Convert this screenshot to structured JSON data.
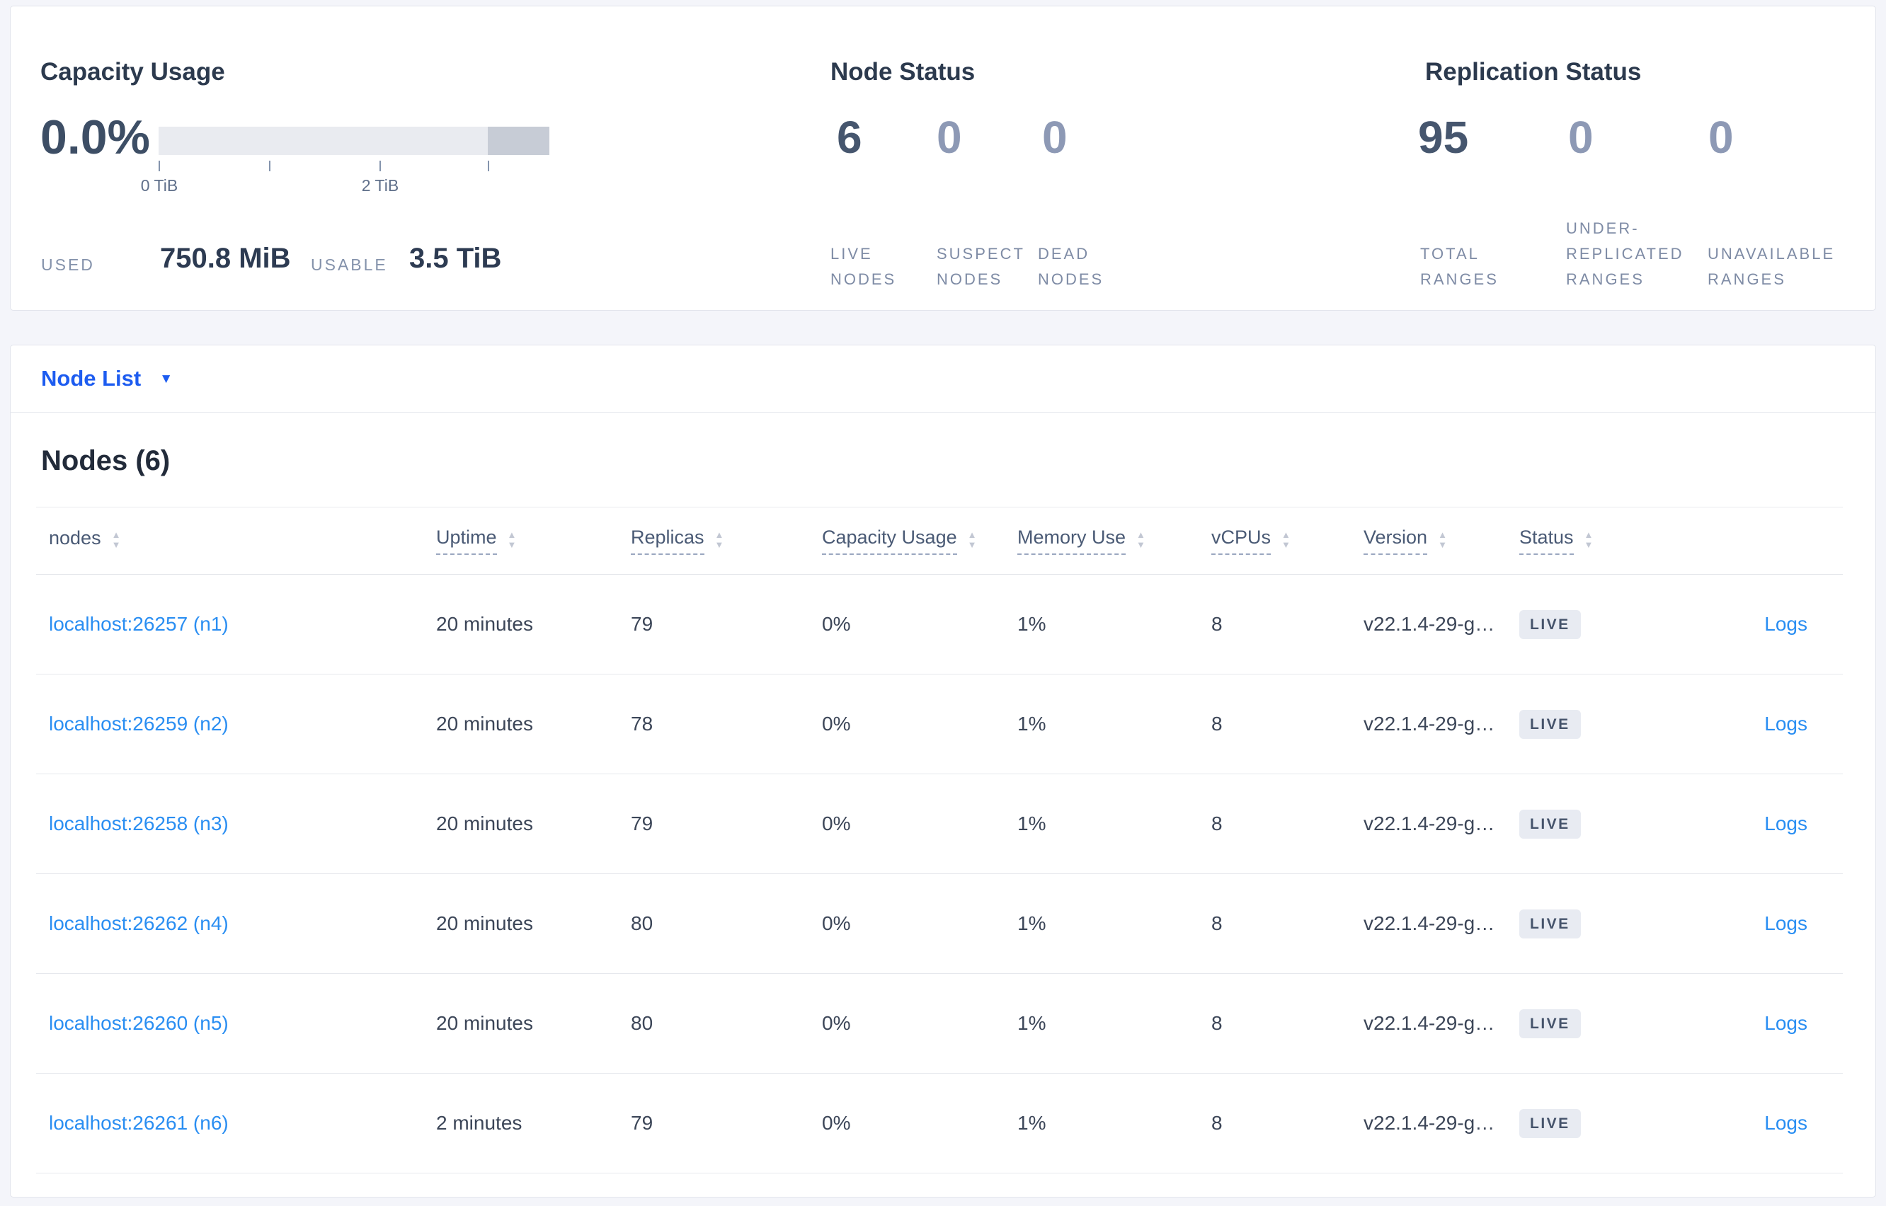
{
  "summary": {
    "capacity": {
      "title": "Capacity Usage",
      "percent": "0.0%",
      "tick_labels": [
        "0 TiB",
        "2 TiB"
      ],
      "used_label": "USED",
      "used_value": "750.8 MiB",
      "usable_label": "USABLE",
      "usable_value": "3.5 TiB"
    },
    "node_status": {
      "title": "Node Status",
      "stats": [
        {
          "value": "6",
          "lines": [
            "LIVE",
            "NODES"
          ]
        },
        {
          "value": "0",
          "lines": [
            "SUSPECT",
            "NODES"
          ]
        },
        {
          "value": "0",
          "lines": [
            "DEAD",
            "NODES"
          ]
        }
      ]
    },
    "replication_status": {
      "title": "Replication Status",
      "stats": [
        {
          "value": "95",
          "lines": [
            "TOTAL",
            "RANGES"
          ]
        },
        {
          "value": "0",
          "lines": [
            "UNDER-",
            "REPLICATED",
            "RANGES"
          ]
        },
        {
          "value": "0",
          "lines": [
            "UNAVAILABLE",
            "RANGES"
          ]
        }
      ]
    }
  },
  "node_list": {
    "selector_label": "Node List",
    "heading": "Nodes (6)",
    "columns": [
      {
        "key": "nodes",
        "label": "nodes",
        "underline": false
      },
      {
        "key": "uptime",
        "label": "Uptime",
        "underline": true
      },
      {
        "key": "replicas",
        "label": "Replicas",
        "underline": true
      },
      {
        "key": "capacity-usage",
        "label": "Capacity Usage",
        "underline": true
      },
      {
        "key": "memory-use",
        "label": "Memory Use",
        "underline": true
      },
      {
        "key": "vcpus",
        "label": "vCPUs",
        "underline": true
      },
      {
        "key": "version",
        "label": "Version",
        "underline": true
      },
      {
        "key": "status",
        "label": "Status",
        "underline": true
      },
      {
        "key": "logs",
        "label": "",
        "underline": false
      }
    ],
    "rows": [
      {
        "node": "localhost:26257 (n1)",
        "uptime": "20 minutes",
        "replicas": "79",
        "capacity": "0%",
        "memory": "1%",
        "vcpus": "8",
        "version": "v22.1.4-29-g…",
        "status": "LIVE",
        "logs": "Logs"
      },
      {
        "node": "localhost:26259 (n2)",
        "uptime": "20 minutes",
        "replicas": "78",
        "capacity": "0%",
        "memory": "1%",
        "vcpus": "8",
        "version": "v22.1.4-29-g…",
        "status": "LIVE",
        "logs": "Logs"
      },
      {
        "node": "localhost:26258 (n3)",
        "uptime": "20 minutes",
        "replicas": "79",
        "capacity": "0%",
        "memory": "1%",
        "vcpus": "8",
        "version": "v22.1.4-29-g…",
        "status": "LIVE",
        "logs": "Logs"
      },
      {
        "node": "localhost:26262 (n4)",
        "uptime": "20 minutes",
        "replicas": "80",
        "capacity": "0%",
        "memory": "1%",
        "vcpus": "8",
        "version": "v22.1.4-29-g…",
        "status": "LIVE",
        "logs": "Logs"
      },
      {
        "node": "localhost:26260 (n5)",
        "uptime": "20 minutes",
        "replicas": "80",
        "capacity": "0%",
        "memory": "1%",
        "vcpus": "8",
        "version": "v22.1.4-29-g…",
        "status": "LIVE",
        "logs": "Logs"
      },
      {
        "node": "localhost:26261 (n6)",
        "uptime": "2 minutes",
        "replicas": "79",
        "capacity": "0%",
        "memory": "1%",
        "vcpus": "8",
        "version": "v22.1.4-29-g…",
        "status": "LIVE",
        "logs": "Logs"
      }
    ]
  },
  "icons": {
    "caret": "▼",
    "sort_up": "▲",
    "sort_down": "▼"
  },
  "colors": {
    "page_bg": "#f4f5fa",
    "card_bg": "#ffffff",
    "primary_blue": "#1d5cf0",
    "link_blue": "#2a8ef2",
    "dark_stat": "#46566e",
    "muted_stat": "#8d99b5",
    "muted_label": "#7e8ba5",
    "bar_light": "#e9ebf0",
    "bar_dark": "#c7ccd6",
    "badge_bg": "#e8ebf2",
    "badge_text": "#45536b"
  }
}
